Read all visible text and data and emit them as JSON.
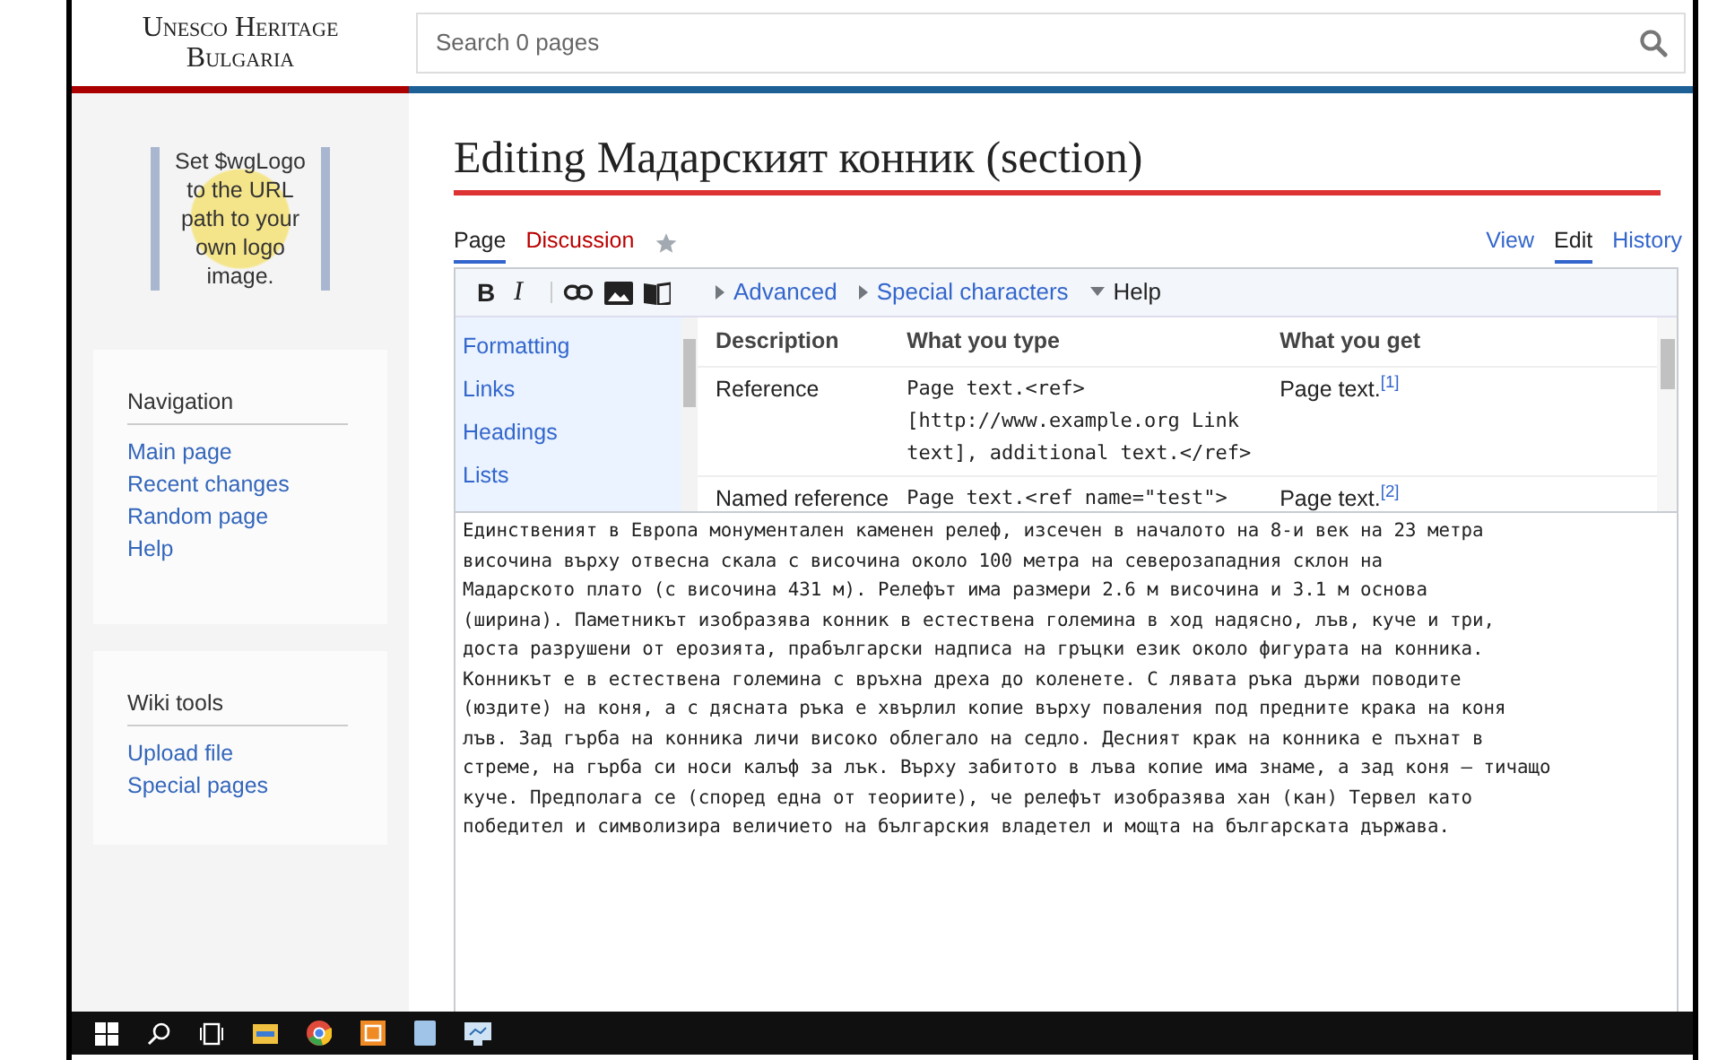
{
  "site_title": "Unesco Heritage Bulgaria",
  "search": {
    "placeholder": "Search 0 pages"
  },
  "logo_text": "Set $wgLogo to the URL path to your own logo image.",
  "sidebar": [
    {
      "heading": "Navigation",
      "items": [
        "Main page",
        "Recent changes",
        "Random page",
        "Help"
      ]
    },
    {
      "heading": "Wiki tools",
      "items": [
        "Upload file",
        "Special pages"
      ]
    }
  ],
  "page_title": "Editing Мадарският конник (section)",
  "namespace_tabs": [
    {
      "label": "Page",
      "selected": true,
      "kind": "link"
    },
    {
      "label": "Discussion",
      "selected": false,
      "kind": "redlink"
    },
    {
      "kind": "star",
      "selected": false
    }
  ],
  "view_tabs": [
    {
      "label": "View",
      "selected": false
    },
    {
      "label": "Edit",
      "selected": true
    },
    {
      "label": "History",
      "selected": false
    }
  ],
  "toolbar": {
    "buttons": [
      {
        "kind": "bold",
        "label": "B"
      },
      {
        "kind": "italic",
        "label": "I"
      },
      {
        "kind": "link"
      },
      {
        "kind": "image"
      },
      {
        "kind": "book"
      }
    ],
    "sections": [
      {
        "label": "Advanced",
        "expanded": false
      },
      {
        "label": "Special characters",
        "expanded": false
      },
      {
        "label": "Help",
        "expanded": true
      }
    ]
  },
  "help": {
    "categories": [
      {
        "label": "Formatting",
        "selected": false
      },
      {
        "label": "Links",
        "selected": false
      },
      {
        "label": "Headings",
        "selected": false
      },
      {
        "label": "Lists",
        "selected": false
      }
    ],
    "columns": [
      "Description",
      "What you type",
      "What you get"
    ],
    "rows": [
      [
        "Reference",
        "Page text.<ref>\n[http://www.example.org Link text], additional text.</ref>",
        "Page text.$^{[1]}$"
      ],
      [
        "Named reference",
        "Page text.<ref name=\"test\">",
        "Page text.$^{[2]}$"
      ]
    ]
  },
  "editor_lines": [
    "Единственият в Европа монументален каменен релеф, изсечен в началото на 8-и век на 23 метра",
    "височина върху отвесна скала с височина около 100 метра на северозападния склон на",
    "Мадарското плато (с височина 431 м). Релефът има размери 2.6 м височина и 3.1 м основа",
    "(ширина). Паметникът изобразява конник в естествена големина в ход надясно, лъв, куче и три,",
    "доста разрушени от ерозията, прабългарски надписа на гръцки език около фигурата на конника.",
    "Конникът е в естествена големина с връхна дреха до коленете. С лявата ръка държи поводите",
    "(юздите) на коня, а с дясната ръка е хвърлил копие върху поваления под предните крака на коня",
    "лъв. Зад гърба на конника личи високо облегало на седло. Десният крак на конника е пъхнат в",
    "стреме, на гърба си носи калъф за лък. Върху забитото в лъва копие има знаме, а зад коня – тичащо",
    "куче. Предполага се (според една от теориите), че релефът изобразява хан (кан) Тервел като",
    "победител и символизира величието на българския владетел и мощта на българската държава."
  ],
  "taskbar": [
    {
      "kind": "windows"
    },
    {
      "kind": "search"
    },
    {
      "kind": "taskview"
    },
    {
      "kind": "folder"
    },
    {
      "kind": "browser"
    },
    {
      "kind": "app"
    },
    {
      "kind": "notes"
    },
    {
      "kind": "monitor"
    }
  ]
}
